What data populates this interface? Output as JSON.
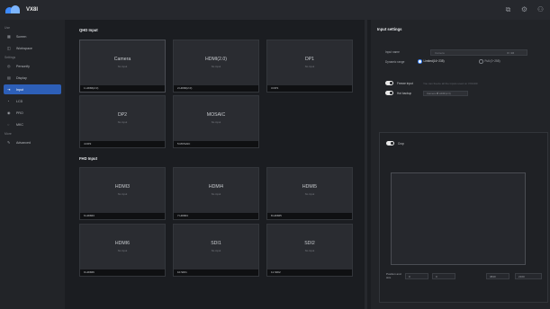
{
  "app": {
    "name": "VX8I"
  },
  "topbar": {
    "icons": [
      "monitor-icon",
      "gear-icon",
      "user-icon"
    ]
  },
  "sidebar": {
    "groups": [
      {
        "label": "Use",
        "items": [
          {
            "label": "Screen",
            "icon": "screen-icon"
          },
          {
            "label": "Workspace",
            "icon": "workspace-icon"
          }
        ]
      },
      {
        "label": "Settings",
        "items": [
          {
            "label": "Personify",
            "icon": "personify-icon"
          },
          {
            "label": "Display",
            "icon": "display-icon"
          },
          {
            "label": "Input",
            "icon": "input-icon",
            "active": true
          },
          {
            "label": "LCD",
            "icon": "lcd-icon"
          },
          {
            "label": "PRO",
            "icon": "pro-icon"
          },
          {
            "label": "MKC",
            "icon": "mkc-icon"
          }
        ]
      },
      {
        "label": "More",
        "items": [
          {
            "label": "Advanced",
            "icon": "wrench-icon"
          }
        ]
      }
    ]
  },
  "main": {
    "qhd_title": "QHD Input",
    "fhd_title": "FHD Input",
    "qhd_cards": [
      {
        "title": "Camera",
        "sub": "No input",
        "foot": "1.HDMI(2.0)"
      },
      {
        "title": "HDMI(2.0)",
        "sub": "No input",
        "foot": "2.HDMI(2.0)"
      },
      {
        "title": "DP1",
        "sub": "No input",
        "foot": "3.DP1"
      },
      {
        "title": "DP2",
        "sub": "No input",
        "foot": "4.DP2"
      },
      {
        "title": "MOSAIC",
        "sub": "No input",
        "foot": "5.MOSAIC"
      }
    ],
    "fhd_cards": [
      {
        "title": "HDMI3",
        "sub": "No input",
        "foot": "6.HDMI3"
      },
      {
        "title": "HDMI4",
        "sub": "No input",
        "foot": "7.HDMI4"
      },
      {
        "title": "HDMI5",
        "sub": "No input",
        "foot": "8.HDMI5"
      },
      {
        "title": "HDMI6",
        "sub": "No input",
        "foot": "9.HDMI6"
      },
      {
        "title": "SDI1",
        "sub": "No input",
        "foot": "10.SDI1"
      },
      {
        "title": "SDI2",
        "sub": "No input",
        "foot": "11.SDI2"
      }
    ]
  },
  "panel": {
    "title": "Input settings",
    "input_name_label": "Input name",
    "input_name_placeholder": "Camera",
    "input_name_count": "6 / 16",
    "dynamic_range_label": "Dynamic range",
    "range_limited": "Limited(16~235)",
    "range_full": "Full (0~255)",
    "freeze_label": "Freeze input",
    "freeze_hint": "You can freeze all the inputs used on VX1000",
    "hot_backup_label": "Hot backup",
    "hot_backup_value": "Camera ⇄ HDMI(2.0)",
    "crop_label": "Crop",
    "position_label": "Position and size",
    "pos_x": "0",
    "pos_y": "0",
    "width": "3840",
    "height": "2160"
  }
}
